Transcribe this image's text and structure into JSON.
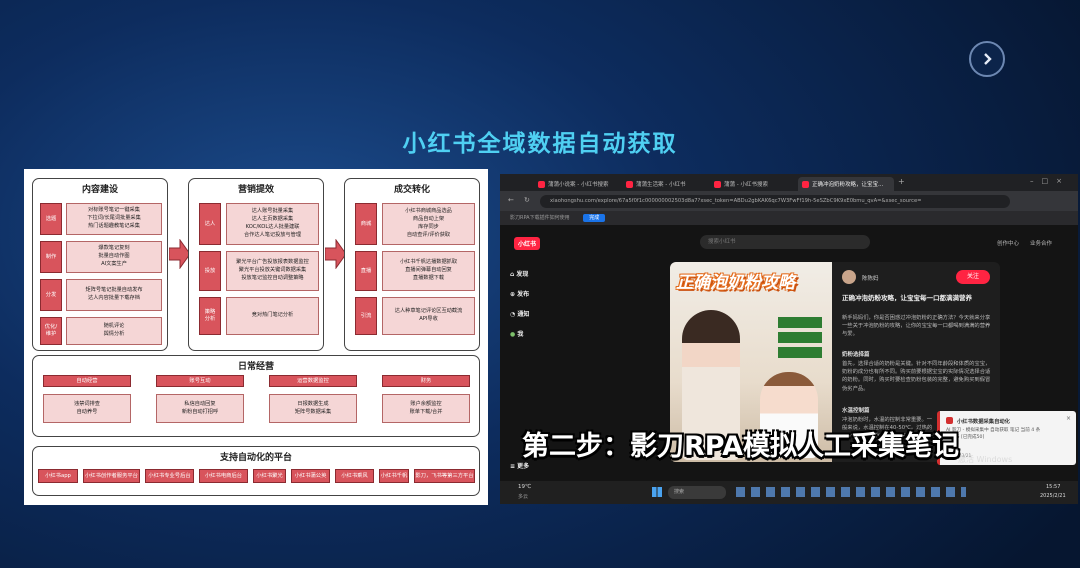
{
  "slide": {
    "title": "小红书全域数据自动获取",
    "next_icon": "chevron-right-icon"
  },
  "diagram": {
    "content": {
      "title": "内容建设",
      "rows": [
        {
          "tag": "选题",
          "text": "对标账号笔记一键采集\n下拉词/长尾词批量采集\n热门话题趣教笔记采集"
        },
        {
          "tag": "制作",
          "text": "爆款笔记复刻\n批量自动作图\nAI文案生产"
        },
        {
          "tag": "分发",
          "text": "矩阵号笔记批量自动发布\n达人内容批量下载存档"
        },
        {
          "tag": "优化/\n维护",
          "text": "随机评论\n舆情分析"
        }
      ]
    },
    "marketing": {
      "title": "营销提效",
      "rows": [
        {
          "tag": "达人",
          "text": "达人账号批量采集\n达人主页数据采集\nKOC/KOL达人批量建联\n合作达人笔记投放与管理"
        },
        {
          "tag": "投放",
          "text": "聚光平台广告投放报表数据监控\n聚光平台投放关键词数据采集\n投放笔记监控自动调整策略"
        },
        {
          "tag": "策略\n分析",
          "text": "竞对热门笔记分析"
        }
      ]
    },
    "conversion": {
      "title": "成交转化",
      "rows": [
        {
          "tag": "商城",
          "text": "小红书商城商品选品\n商品自动上架\n库存同步\n自动查评/评价获取"
        },
        {
          "tag": "直播",
          "text": "小红书千帆达播数据抓取\n直播间弹幕自动回复\n直播数据下载"
        },
        {
          "tag": "引流",
          "text": "达人种草笔记评论区互动截流\nAPI导收"
        }
      ]
    },
    "daily": {
      "title": "日常经营",
      "items": [
        {
          "tag": "自动经营",
          "text": "违禁词排查\n自动养号"
        },
        {
          "tag": "账号互动",
          "text": "私信自动回复\n新粉自动打招呼"
        },
        {
          "tag": "运营数据监控",
          "text": "日报数据生成\n矩阵号数据采集"
        },
        {
          "tag": "财务",
          "text": "账户余额监控\n账单下载/合并"
        }
      ]
    },
    "platforms": {
      "title": "支持自动化的平台",
      "items": [
        "小红书app",
        "小红书创作者服务平台",
        "小红书专业号后台",
        "小红书电商后台",
        "小红书聚光",
        "小红书蒲公英",
        "小红书乘风",
        "小红书千帆",
        "影刀，飞书等第三方平台"
      ]
    }
  },
  "screenshot": {
    "tabs": [
      "蒲蒲小说案 - 小红书搜索",
      "蒲蒲生活案 - 小红书",
      "蒲蒲 - 小红书搜索",
      "正确冲泡奶粉攻略，让宝宝..."
    ],
    "url": "xiaohongshu.com/explore/67a5f0f1c000000002503d8a7?xsec_token=ABDu2gbKAK6qc7W3FwFf19h-5eSZbC9K9xE0bmu_qvA=&xsec_source=",
    "bookmark": "影刀RPA下载插件如何使用",
    "bookmark_btn": "完成",
    "logo": "小红书",
    "search_placeholder": "搜索小红书",
    "top_links": [
      "创作中心",
      "业务合作"
    ],
    "nav": [
      "发现",
      "发布",
      "通知",
      "我",
      "更多"
    ],
    "note": {
      "cover_title": "正确泡奶粉攻略",
      "author": "陈陈妈",
      "follow": "关注",
      "title": "正确冲泡奶粉攻略，让宝宝每一口都满满营养",
      "body": "新手妈妈们，你是否困惑过冲泡奶粉的正确方法？今天就来分享一些关于冲泡奶粉的攻略，让你的宝宝每一口都喝到满满的营养与爱。",
      "section1": "奶粉选择篇",
      "section1_body": "首先，选择合适的奶粉是关键。针对不同年龄段和体质的宝宝，奶粉的成分也有所不同。购买前要根据宝宝的实际情况选择合适的奶粉。同时，购买时要检查奶粉包装的完整，避免购买到假冒伪劣产品。",
      "section2": "水温控制篇",
      "section2_body": "冲泡奶粉时，水温的控制非常重要。一般来说，水温控制在40-50℃。过热的开水会破坏奶粉中的营养成分。"
    },
    "subtitle": "第二步：影刀RPA模拟人工采集笔记",
    "popup": {
      "title": "小红书数据采集自动化",
      "text": "AI 影刀 - 模拟采集中 自动获取 笔记 当前 4 条 剩余 5 [已完成50]",
      "time": "2025/03/21"
    },
    "watermark": "激活 Windows",
    "taskbar": {
      "weather_temp": "19℃",
      "weather_desc": "多云",
      "search": "搜索",
      "time": "15:57",
      "date": "2025/2/21"
    }
  }
}
